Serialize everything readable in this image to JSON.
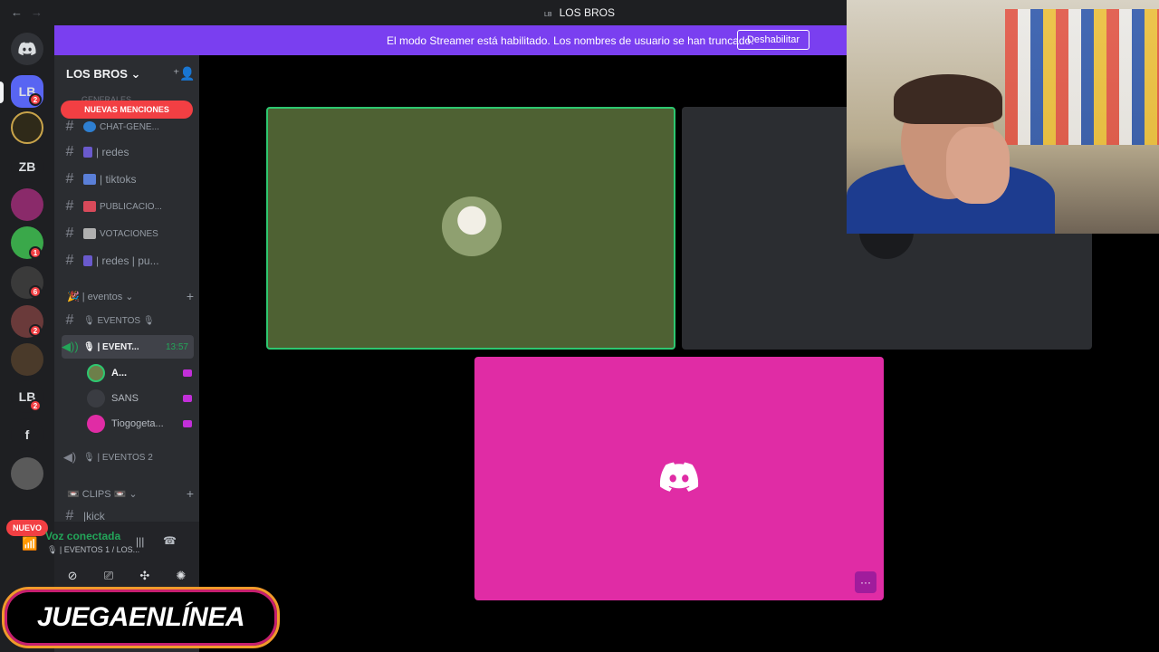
{
  "titlebar": {
    "back": "←",
    "forward": "→",
    "server_tag": "LB",
    "title": "LOS BROS"
  },
  "rail": {
    "discord_glyph": "◉",
    "servers": [
      {
        "label": "LB",
        "badge": "2",
        "color": "#5865f2",
        "selected": true
      },
      {
        "label": "",
        "badge": "",
        "color": "#2f2a19"
      },
      {
        "label": "ZB",
        "badge": "",
        "color": "#1e1f22"
      },
      {
        "label": "",
        "badge": "",
        "color": "#8a2a6a"
      },
      {
        "label": "",
        "badge": "1",
        "color": "#3aa84a"
      },
      {
        "label": "",
        "badge": "6",
        "color": "#3a3a3a"
      },
      {
        "label": "",
        "badge": "2",
        "color": "#6a3a3a"
      },
      {
        "label": "",
        "badge": "",
        "color": "#4a3a2a"
      },
      {
        "label": "LB",
        "badge": "2",
        "color": "#1e1f22"
      },
      {
        "label": "f",
        "badge": "",
        "color": "#1e1f22"
      },
      {
        "label": "",
        "badge": "",
        "color": "#5a5a5a"
      }
    ],
    "nuevo": "NUEVO"
  },
  "streamer_bar": {
    "message": "El modo Streamer está habilitado. Los nombres de usuario se han truncado.",
    "button": "Deshabilitar"
  },
  "sidebar": {
    "server_name": "LOS BROS ⌄",
    "invite_icon": "⁺👤",
    "faded_category": "GENERALES",
    "mention_banner": "NUEVAS MENCIONES",
    "channels_top": [
      {
        "name": "CHAT-GENE...",
        "emoji_color": "#2e7fd1",
        "small": true
      },
      {
        "name": "| redes",
        "emoji_color": "#6a5acd"
      },
      {
        "name": "| tiktoks",
        "emoji_color": "#5a7fd8"
      },
      {
        "name": "PUBLICACIO...",
        "emoji_color": "#d84a5a",
        "small": true
      },
      {
        "name": "VOTACIONES",
        "emoji_color": "#b0b0b0",
        "small": true
      },
      {
        "name": "| redes | pu...",
        "emoji_color": "#6a5acd"
      }
    ],
    "category_eventos": "| eventos ⌄",
    "channel_eventos_text": "🎙 EVENTOS 🎙",
    "voice_channel_active": "🎙 | EVENT...",
    "voice_channel_time": "13:57",
    "members": [
      {
        "name": "A...",
        "color": "#6d7f4a"
      },
      {
        "name": "SANS",
        "color": "#3a3c42"
      },
      {
        "name": "Tiogogeta...",
        "color": "#e02ca5"
      }
    ],
    "voice_channel_2": "🎙 | EVENTOS 2",
    "category_clips": "📼 CLIPS 📼 ⌄",
    "channel_kick": "|kick"
  },
  "voice_panel": {
    "status": "Voz conectada",
    "channel": "🎙 | EVENTOS 1 / LOS...",
    "buttons": [
      "⊘",
      "⎚",
      "✣",
      "✺"
    ]
  },
  "stage": {
    "more_label": "···"
  },
  "brand": {
    "text": "JUEGAENLÍNEA"
  }
}
